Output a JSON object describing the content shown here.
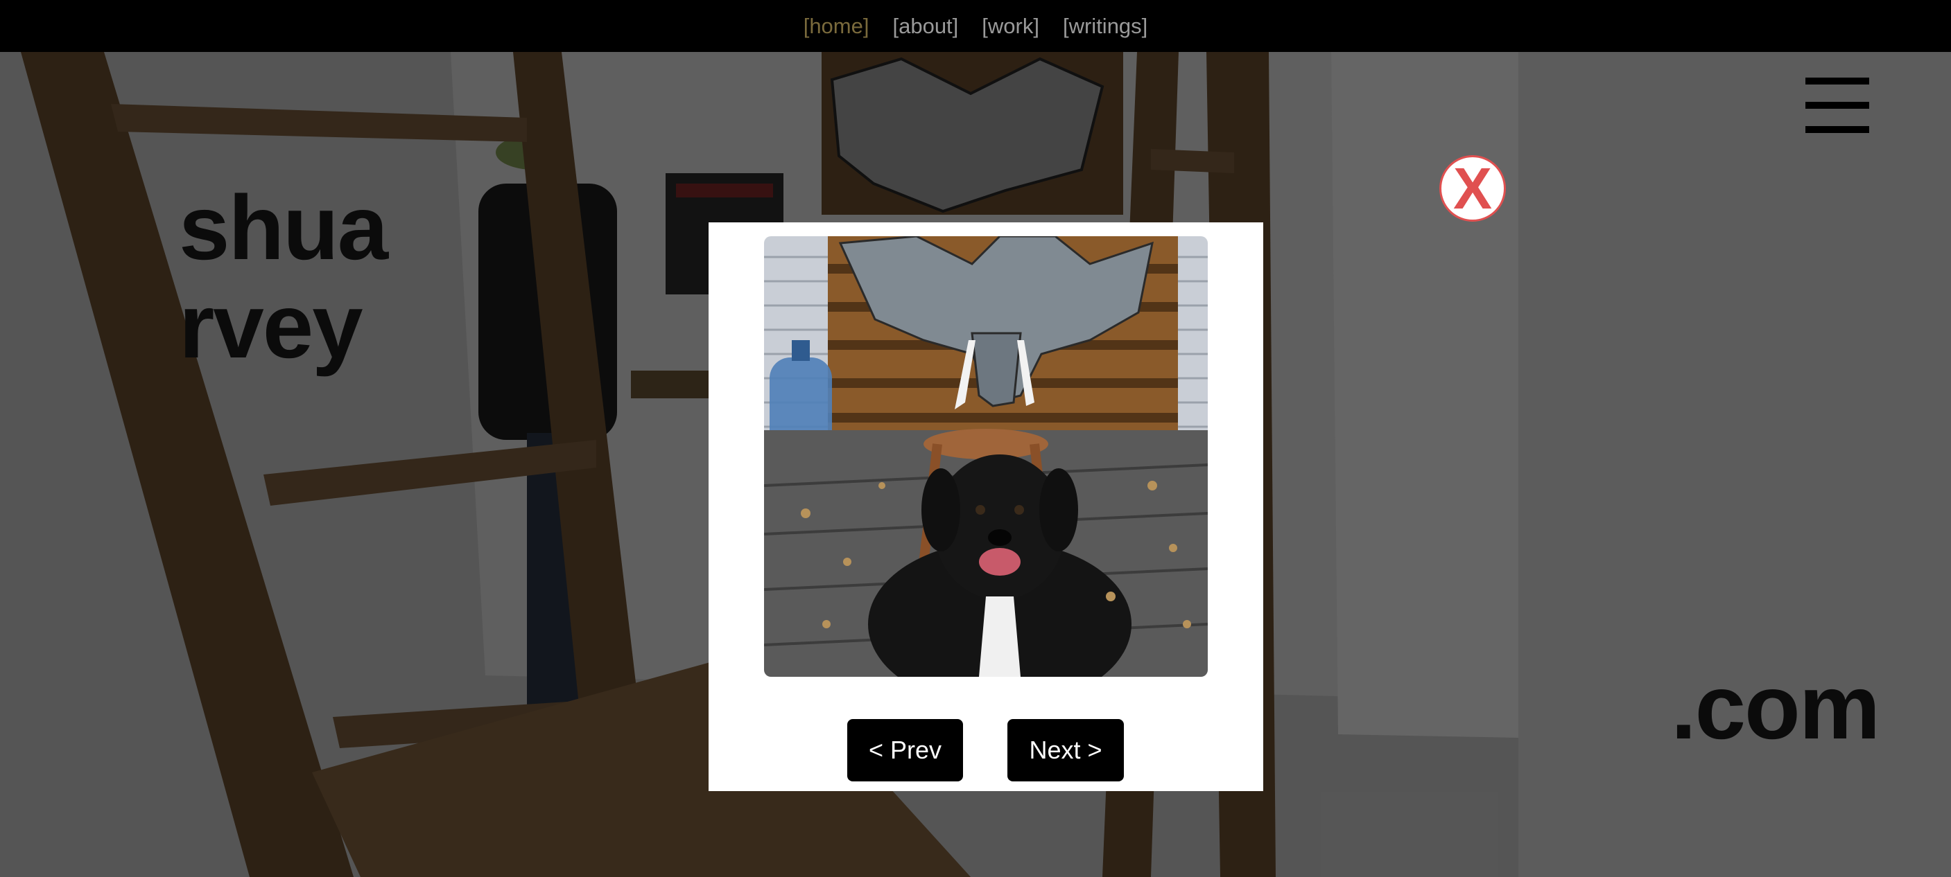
{
  "nav": {
    "items": [
      "[home]",
      "[about]",
      "[work]",
      "[writings]"
    ],
    "active_index": 0
  },
  "hero": {
    "line1": "shua",
    "line2": "rvey",
    "line3": ".com"
  },
  "modal": {
    "prev_label": "< Prev",
    "next_label": "Next >",
    "close_label": "X"
  },
  "colors": {
    "nav_bg": "#000000",
    "nav_link": "#9a9a9a",
    "nav_active": "#7a6a3c",
    "close_accent": "#e05050",
    "button_bg": "#000000"
  }
}
